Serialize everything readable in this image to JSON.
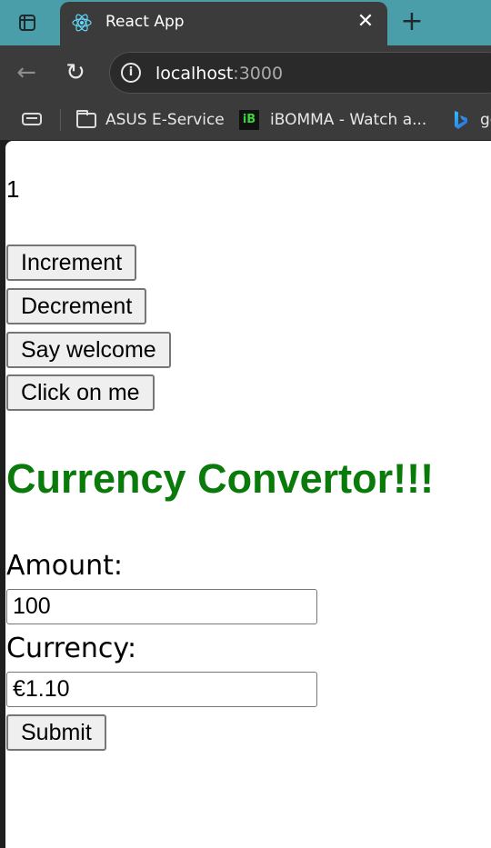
{
  "browser": {
    "tab_title": "React App",
    "url_host": "localhost",
    "url_port": ":3000",
    "bookmarks": [
      {
        "label": "ASUS E-Service",
        "icon": "folder-icon"
      },
      {
        "label": "iBOMMA - Watch a...",
        "icon": "ibomma-icon"
      },
      {
        "label": "ge",
        "icon": "bing-icon"
      }
    ],
    "ib_icon_text": "iB"
  },
  "app": {
    "count": "1",
    "buttons": {
      "increment": "Increment",
      "decrement": "Decrement",
      "say_welcome": "Say welcome",
      "click_on_me": "Click on me"
    },
    "converter": {
      "heading": "Currency Convertor!!!",
      "heading_color": "#0a7a0a",
      "amount_label": "Amount:",
      "amount_value": "100",
      "currency_label": "Currency:",
      "currency_value": "€1.10",
      "submit_label": "Submit"
    }
  }
}
